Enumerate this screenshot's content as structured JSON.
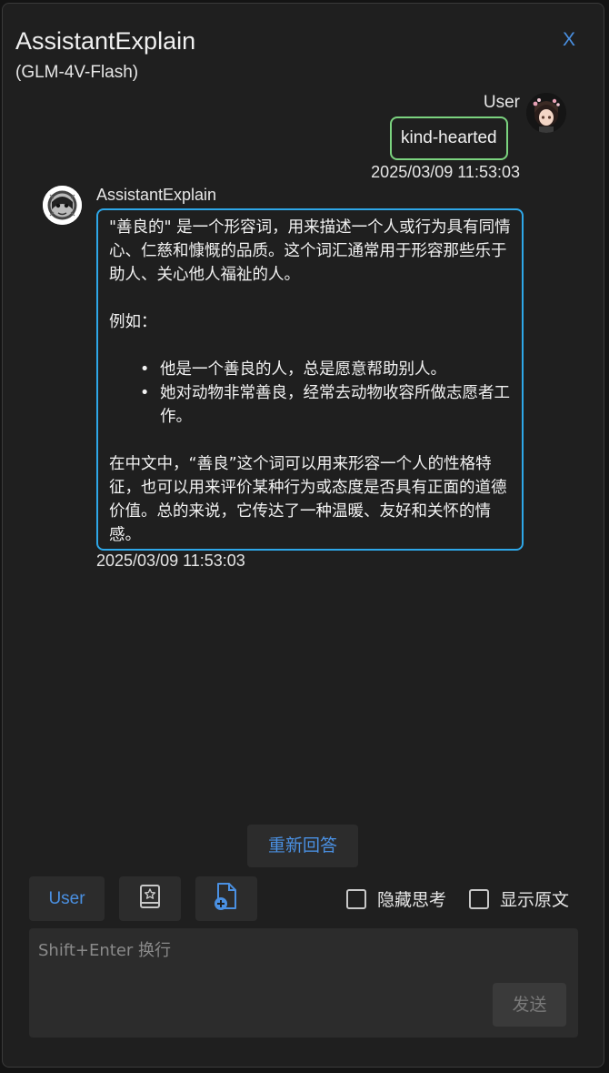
{
  "window": {
    "title": "AssistantExplain",
    "subtitle": "(GLM-4V-Flash)",
    "close_label": "X"
  },
  "user_message": {
    "name": "User",
    "text": "kind-hearted",
    "time": "2025/03/09 11:53:03"
  },
  "assistant_message": {
    "name": "AssistantExplain",
    "paragraph1": "\"善良的\" 是一个形容词，用来描述一个人或行为具有同情心、仁慈和慷慨的品质。这个词汇通常用于形容那些乐于助人、关心他人福祉的人。",
    "example_label": "例如：",
    "examples": [
      "他是一个善良的人，总是愿意帮助别人。",
      "她对动物非常善良，经常去动物收容所做志愿者工作。"
    ],
    "paragraph2": "在中文中，“善良”这个词可以用来形容一个人的性格特征，也可以用来评价某种行为或态度是否具有正面的道德价值。总的来说，它传达了一种温暖、友好和关怀的情感。",
    "time": "2025/03/09 11:53:03"
  },
  "controls": {
    "regenerate_label": "重新回答",
    "role_label": "User",
    "hide_thinking_label": "隐藏思考",
    "show_original_label": "显示原文",
    "input_placeholder": "Shift+Enter 换行",
    "send_label": "发送"
  },
  "icons": {
    "prompt": "bookmark-star-icon",
    "file": "file-add-icon"
  },
  "colors": {
    "accent": "#4a90e2",
    "user_bubble_border": "#7bd37f",
    "assistant_bubble_border": "#2ea7e8"
  }
}
